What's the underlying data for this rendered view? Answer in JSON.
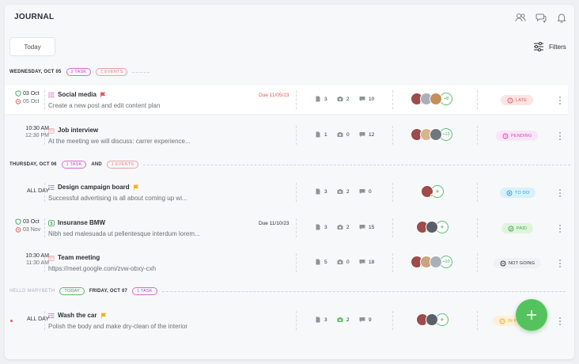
{
  "header": {
    "title": "JOURNAL",
    "icons": [
      "users-icon",
      "chat-icon",
      "bell-icon"
    ]
  },
  "toolbar": {
    "today_label": "Today",
    "filters_label": "Filters"
  },
  "days": [
    {
      "label": "WEDNESDAY, OCT 05",
      "task_pill": "2 TASK",
      "event_pill": "1 EVENTS"
    },
    {
      "label": "THURSDAY, OCT 06",
      "task_pill": "1 TASK",
      "and": "AND",
      "event_pill": "1 EVENTS"
    },
    {
      "hello": "HELLO MARYBETH",
      "today_pill": "TODAY",
      "label": "FRIDAY, OCT 07",
      "task_pill": "1 TASK"
    }
  ],
  "rows": [
    {
      "time1": "03 Oct",
      "time2": "05 Oct",
      "title": "Social media",
      "desc": "Create a new post and edit content plan",
      "due": "Due 11/05/23",
      "files": "3",
      "photos": "2",
      "comments": "10",
      "more": "+8",
      "status": "LATE"
    },
    {
      "time1": "10:30 AM",
      "time2": "12:30 PM",
      "title": "Job interview",
      "desc": "At the meeting we will discuss: carrer experience...",
      "files": "1",
      "photos": "0",
      "comments": "12",
      "more": "+12",
      "status": "PENDING"
    },
    {
      "time1": "ALL DAY",
      "title": "Design campaign board",
      "desc": "Successful advertising is all about coming up wi...",
      "files": "3",
      "photos": "2",
      "comments": "0",
      "status": "TO DO"
    },
    {
      "time1": "03 Oct",
      "time2": "03 Nov",
      "title": "Insuranse BMW",
      "desc": "Nibh sed malesuada ut pellentesque interdum lorem...",
      "due": "Due 11/10/23",
      "files": "3",
      "photos": "2",
      "comments": "15",
      "status": "PAID"
    },
    {
      "time1": "10:30 AM",
      "time2": "11:30 AM",
      "title": "Team meeting",
      "desc": "https://meet.google.com/zvw-obxy-cxh",
      "files": "5",
      "photos": "0",
      "comments": "18",
      "more": "+10",
      "status": "NOT GOING"
    },
    {
      "time1": "ALL DAY",
      "title": "Wash the car",
      "desc": "Polish the body and make dry-clean of the interior",
      "files": "3",
      "photos": "2",
      "comments": "9",
      "status": "IN PR"
    }
  ],
  "colors": {
    "accent": "#55c35d",
    "late": "#e25b5b",
    "pending": "#c84dbb",
    "todo": "#2ea3cf",
    "paid": "#3fa554",
    "progress": "#e8a530"
  }
}
